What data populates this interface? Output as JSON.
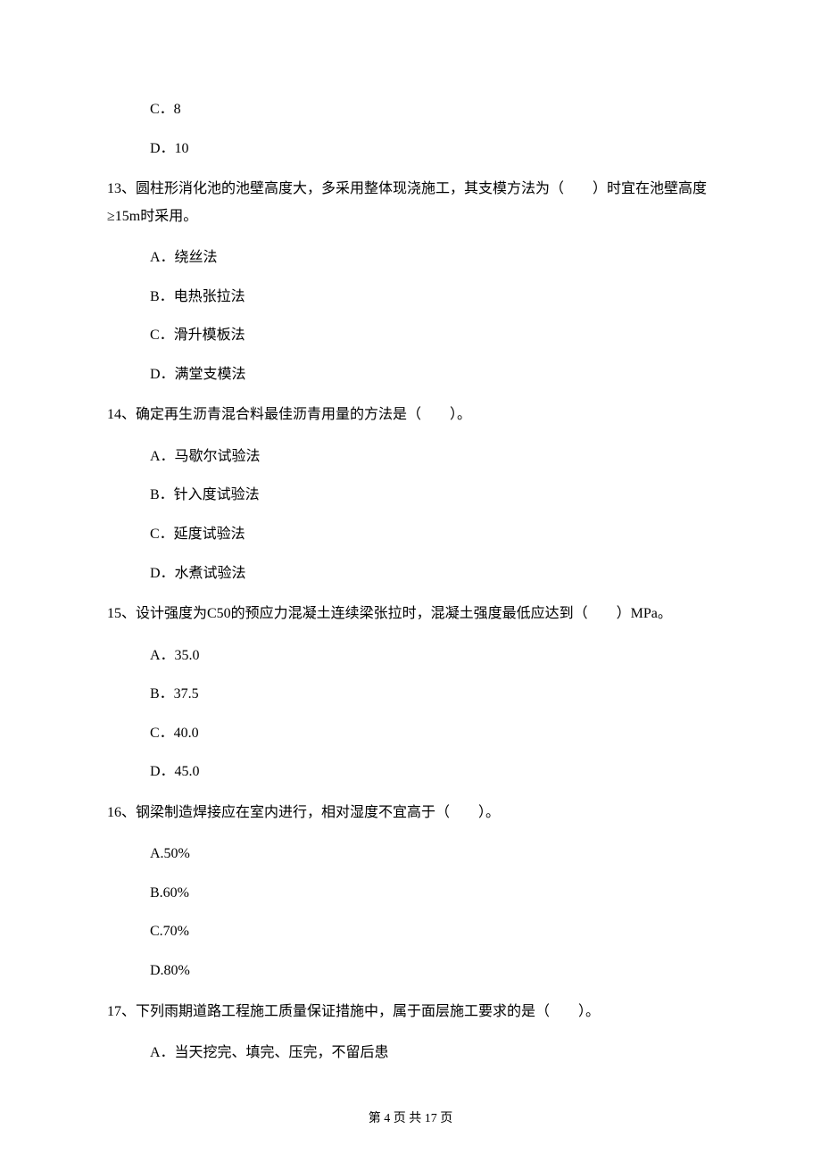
{
  "orphan_options": {
    "c": "C．8",
    "d": "D．10"
  },
  "questions": [
    {
      "stem": "13、圆柱形消化池的池壁高度大，多采用整体现浇施工，其支模方法为（　　）时宜在池壁高度≥15m时采用。",
      "options": {
        "a": "A．绕丝法",
        "b": "B．电热张拉法",
        "c": "C．滑升模板法",
        "d": "D．满堂支模法"
      }
    },
    {
      "stem": "14、确定再生沥青混合料最佳沥青用量的方法是（　　）。",
      "options": {
        "a": "A．马歇尔试验法",
        "b": "B．针入度试验法",
        "c": "C．延度试验法",
        "d": "D．水煮试验法"
      }
    },
    {
      "stem": "15、设计强度为C50的预应力混凝土连续梁张拉时，混凝土强度最低应达到（　　）MPa。",
      "options": {
        "a": "A．35.0",
        "b": "B．37.5",
        "c": "C．40.0",
        "d": "D．45.0"
      }
    },
    {
      "stem": "16、钢梁制造焊接应在室内进行，相对湿度不宜高于（　　）。",
      "options": {
        "a": "A.50%",
        "b": "B.60%",
        "c": "C.70%",
        "d": "D.80%"
      }
    },
    {
      "stem": "17、下列雨期道路工程施工质量保证措施中，属于面层施工要求的是（　　）。",
      "options": {
        "a": "A．当天挖完、填完、压完，不留后患"
      }
    }
  ],
  "footer": "第 4 页 共 17 页"
}
